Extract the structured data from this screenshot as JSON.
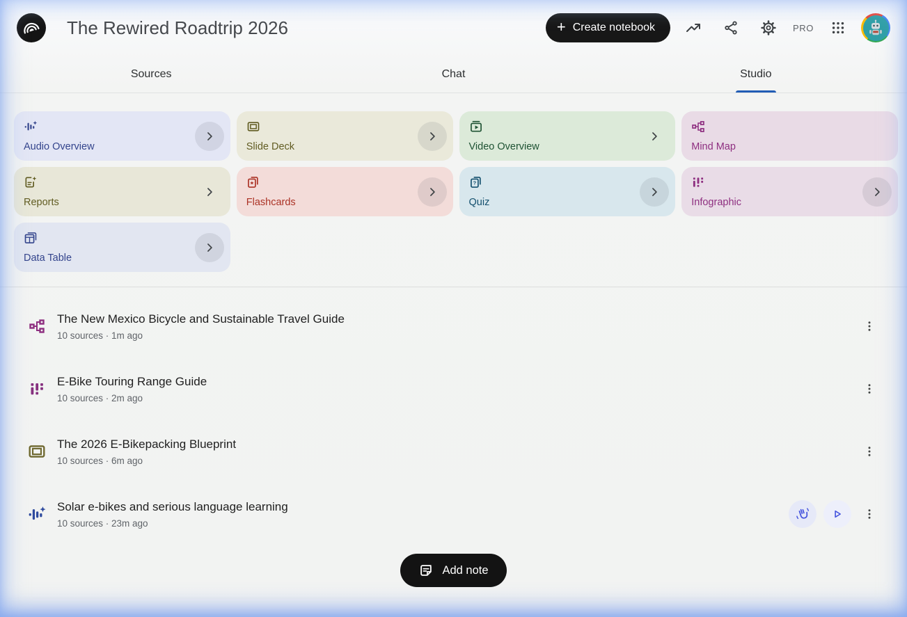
{
  "header": {
    "title": "The Rewired Roadtrip 2026",
    "create_button": "Create notebook",
    "pro_badge": "PRO",
    "action_icons": [
      "trending-icon",
      "share-icon",
      "settings-icon",
      "apps-grid-icon",
      "avatar"
    ]
  },
  "tabs": [
    {
      "label": "Sources",
      "active": false
    },
    {
      "label": "Chat",
      "active": false
    },
    {
      "label": "Studio",
      "active": true
    }
  ],
  "theme": {
    "accent_underline": "#215cb5",
    "button_black": "#171717",
    "page_glow_blue": "#a9c4ee"
  },
  "studio": {
    "cards": [
      {
        "label": "Audio Overview",
        "icon": "audio-waveform-sparkle-icon",
        "bg": "#e3e6f5",
        "fg": "#33448c"
      },
      {
        "label": "Slide Deck",
        "icon": "slide-deck-icon",
        "bg": "#eae9da",
        "fg": "#615c22"
      },
      {
        "label": "Video Overview",
        "icon": "video-overview-icon",
        "bg": "#dcead9",
        "fg": "#1e5233"
      },
      {
        "label": "Mind Map",
        "icon": "mind-map-icon",
        "bg": "#e9dbe6",
        "fg": "#8e2f80"
      },
      {
        "label": "Reports",
        "icon": "report-sparkle-icon",
        "bg": "#e8e7d8",
        "fg": "#615c22"
      },
      {
        "label": "Flashcards",
        "icon": "flashcards-star-icon",
        "bg": "#f3dcd9",
        "fg": "#ab3225"
      },
      {
        "label": "Quiz",
        "icon": "quiz-cards-icon",
        "bg": "#d8e7ed",
        "fg": "#14506e"
      },
      {
        "label": "Infographic",
        "icon": "infographic-bars-icon",
        "bg": "#e9dce7",
        "fg": "#8e2f80"
      },
      {
        "label": "Data Table",
        "icon": "data-table-icon",
        "bg": "#e2e6f1",
        "fg": "#33448c"
      }
    ]
  },
  "list": {
    "items": [
      {
        "title": "The New Mexico Bicycle and Sustainable Travel Guide",
        "meta": "10 sources · 1m ago",
        "icon": "mind-map-icon",
        "color": "#8e2f80"
      },
      {
        "title": "E-Bike Touring Range Guide",
        "meta": "10 sources · 2m ago",
        "icon": "infographic-bars-icon",
        "color": "#86307f"
      },
      {
        "title": "The 2026 E-Bikepacking Blueprint",
        "meta": "10 sources · 6m ago",
        "icon": "slide-deck-icon",
        "color": "#6f6930"
      },
      {
        "title": "Solar e-bikes and serious language learning",
        "meta": "10 sources · 23m ago",
        "icon": "audio-waveform-sparkle-icon",
        "color": "#2e4a9e",
        "action_icons": [
          "interactive-mode-hand-icon",
          "play-icon"
        ]
      }
    ]
  },
  "footer": {
    "add_note_label": "Add note"
  }
}
